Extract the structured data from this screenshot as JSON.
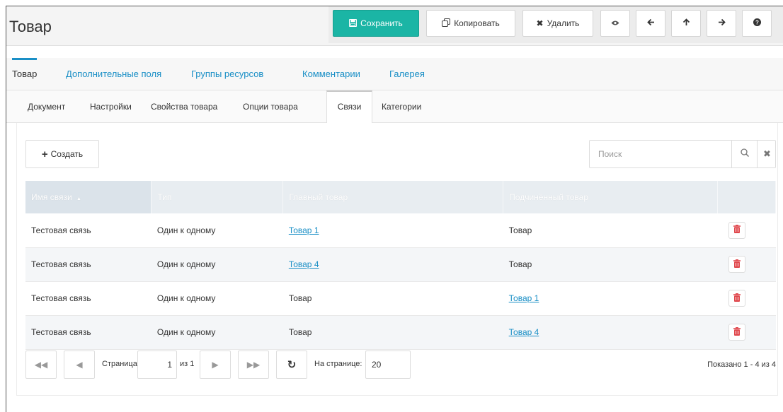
{
  "header": {
    "title": "Товар",
    "toolbar": {
      "save_label": "Сохранить",
      "copy_label": "Копировать",
      "delete_label": "Удалить"
    }
  },
  "tabs_main": [
    {
      "label": "Товар",
      "active": true
    },
    {
      "label": "Дополнительные поля",
      "active": false
    },
    {
      "label": "Группы ресурсов",
      "active": false
    },
    {
      "label": "Комментарии",
      "active": false
    },
    {
      "label": "Галерея",
      "active": false
    }
  ],
  "tabs_sub": [
    {
      "label": "Документ",
      "active": false
    },
    {
      "label": "Настройки",
      "active": false
    },
    {
      "label": "Свойства товара",
      "active": false
    },
    {
      "label": "Опции товара",
      "active": false
    },
    {
      "label": "Связи",
      "active": true
    },
    {
      "label": "Категории",
      "active": false
    }
  ],
  "panel": {
    "create_label": "Создать",
    "search_placeholder": "Поиск"
  },
  "table": {
    "columns": [
      "Имя связи",
      "Тип",
      "Главный товар",
      "Подчинённый товар"
    ],
    "sort_indicator": "▲",
    "rows": [
      {
        "name": "Тестовая связь",
        "type": "Один к одному",
        "master": "Товар 1",
        "master_link": true,
        "slave": "Товар",
        "slave_link": false
      },
      {
        "name": "Тестовая связь",
        "type": "Один к одному",
        "master": "Товар 4",
        "master_link": true,
        "slave": "Товар",
        "slave_link": false
      },
      {
        "name": "Тестовая связь",
        "type": "Один к одному",
        "master": "Товар",
        "master_link": false,
        "slave": "Товар 1",
        "slave_link": true
      },
      {
        "name": "Тестовая связь",
        "type": "Один к одному",
        "master": "Товар",
        "master_link": false,
        "slave": "Товар 4",
        "slave_link": true
      }
    ]
  },
  "pager": {
    "page_label": "Страница",
    "page_value": "1",
    "of_label": "из 1",
    "per_page_label": "На странице:",
    "per_page_value": "20",
    "showing": "Показано 1 - 4 из 4"
  },
  "colors": {
    "accent": "#1bb5a5",
    "link": "#1a8fc6",
    "delete": "#e0474c"
  }
}
